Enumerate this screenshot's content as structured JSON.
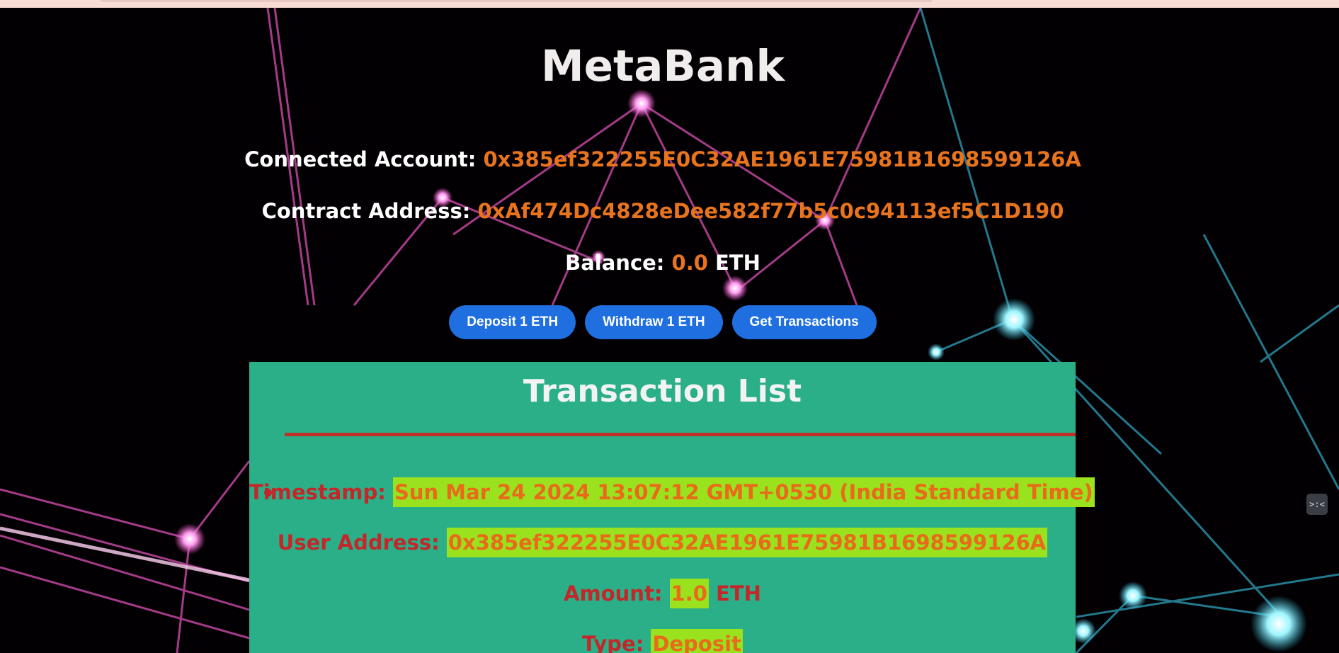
{
  "app": {
    "title": "MetaBank"
  },
  "account": {
    "connected_label": "Connected Account:",
    "connected_value": "0x385ef322255E0C32AE1961E75981B1698599126A",
    "contract_label": "Contract Address:",
    "contract_value": "0xAf474Dc4828eDee582f77b5c0c94113ef5C1D190",
    "balance_label": "Balance:",
    "balance_value": "0.0",
    "balance_unit": "ETH"
  },
  "actions": {
    "deposit": "Deposit 1 ETH",
    "withdraw": "Withdraw 1 ETH",
    "get_transactions": "Get Transactions"
  },
  "transactions": {
    "title": "Transaction List",
    "items": [
      {
        "timestamp_label": "Timestamp:",
        "timestamp": "Sun Mar 24 2024 13:07:12 GMT+0530 (India Standard Time)",
        "user_label": "User Address:",
        "user": "0x385ef322255E0C32AE1961E75981B1698599126A",
        "amount_label": "Amount:",
        "amount": "1.0",
        "amount_unit": "ETH",
        "type_label": "Type:",
        "type": "Deposit"
      }
    ]
  },
  "icons": {
    "devtools": "devtools-icon",
    "side_glyph": ">:<"
  },
  "colors": {
    "accent": "#e8741d",
    "button": "#1f6fe0",
    "panel": "#2baf88",
    "panel_text": "#c3272a",
    "highlight": "#9be21e"
  }
}
